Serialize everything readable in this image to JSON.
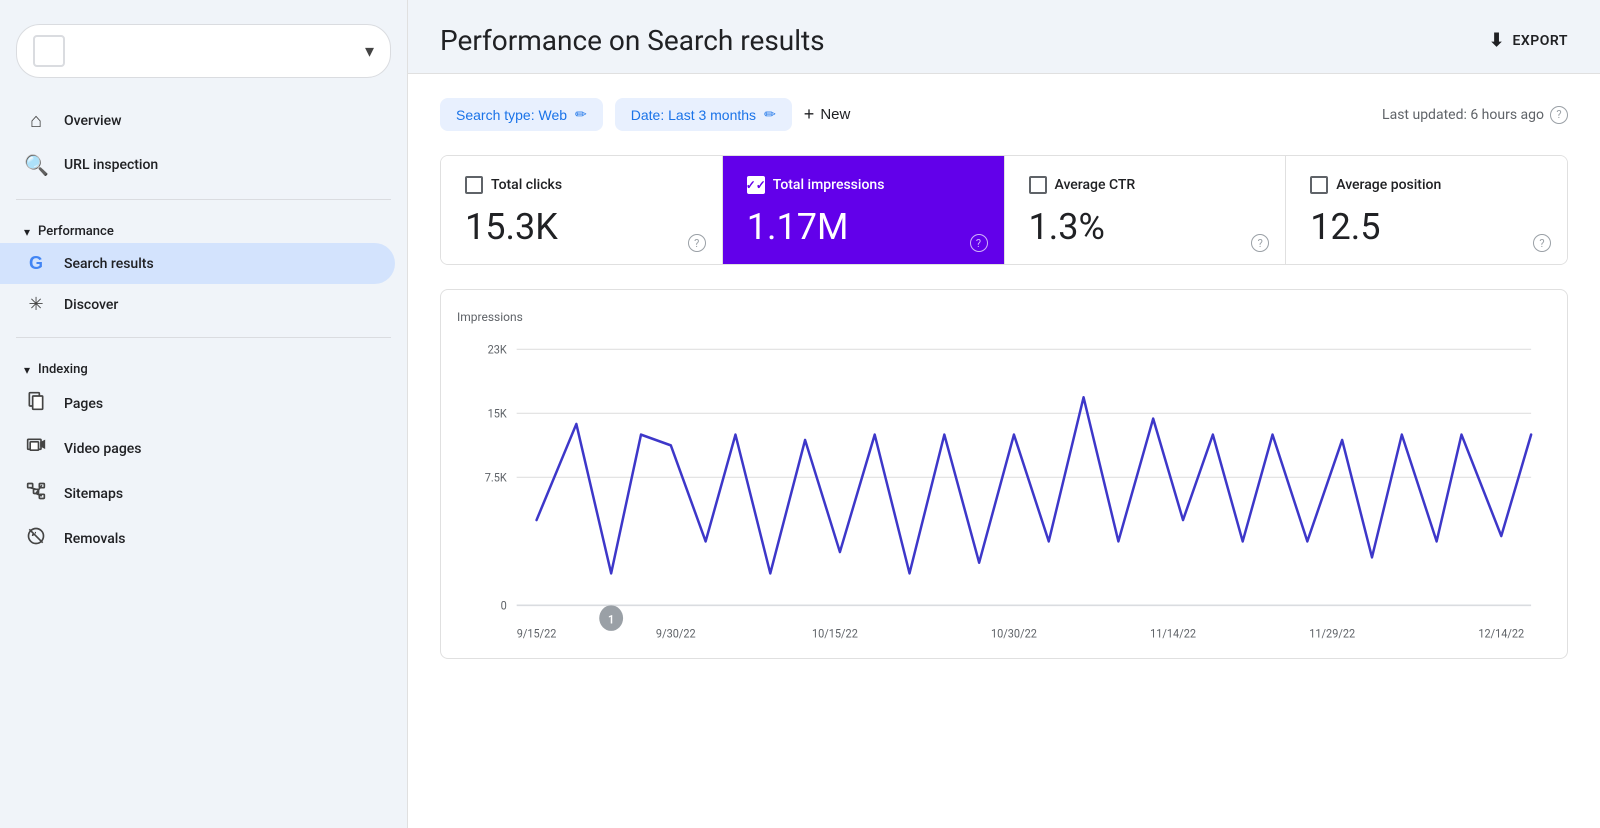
{
  "sidebar": {
    "property_placeholder": "",
    "nav_items": [
      {
        "id": "overview",
        "label": "Overview",
        "icon": "🏠",
        "active": false
      },
      {
        "id": "url-inspection",
        "label": "URL inspection",
        "icon": "🔍",
        "active": false
      }
    ],
    "sections": [
      {
        "id": "performance",
        "label": "Performance",
        "items": [
          {
            "id": "search-results",
            "label": "Search results",
            "icon": "G",
            "active": true,
            "isGoogle": true
          }
        ]
      },
      {
        "id": "discover",
        "label": "",
        "items": [
          {
            "id": "discover",
            "label": "Discover",
            "icon": "✳",
            "active": false
          }
        ]
      },
      {
        "id": "indexing",
        "label": "Indexing",
        "items": [
          {
            "id": "pages",
            "label": "Pages",
            "icon": "📄",
            "active": false
          },
          {
            "id": "video-pages",
            "label": "Video pages",
            "icon": "📺",
            "active": false
          },
          {
            "id": "sitemaps",
            "label": "Sitemaps",
            "icon": "📊",
            "active": false
          },
          {
            "id": "removals",
            "label": "Removals",
            "icon": "🚫",
            "active": false
          }
        ]
      }
    ]
  },
  "header": {
    "title": "Performance on Search results",
    "export_label": "EXPORT"
  },
  "filters": {
    "search_type_label": "Search type: Web",
    "date_label": "Date: Last 3 months",
    "new_label": "New",
    "last_updated": "Last updated: 6 hours ago"
  },
  "metrics": [
    {
      "id": "total-clicks",
      "label": "Total clicks",
      "value": "15.3K",
      "active": false,
      "checked": false
    },
    {
      "id": "total-impressions",
      "label": "Total impressions",
      "value": "1.17M",
      "active": true,
      "checked": true
    },
    {
      "id": "average-ctr",
      "label": "Average CTR",
      "value": "1.3%",
      "active": false,
      "checked": false
    },
    {
      "id": "average-position",
      "label": "Average position",
      "value": "12.5",
      "active": false,
      "checked": false
    }
  ],
  "chart": {
    "y_label": "Impressions",
    "y_axis": [
      "23K",
      "15K",
      "7.5K",
      "0"
    ],
    "x_axis": [
      "9/15/22",
      "9/30/22",
      "10/15/22",
      "10/30/22",
      "11/14/22",
      "11/29/22",
      "12/14/22"
    ],
    "annotation": "1",
    "color": "#3d37c9"
  }
}
